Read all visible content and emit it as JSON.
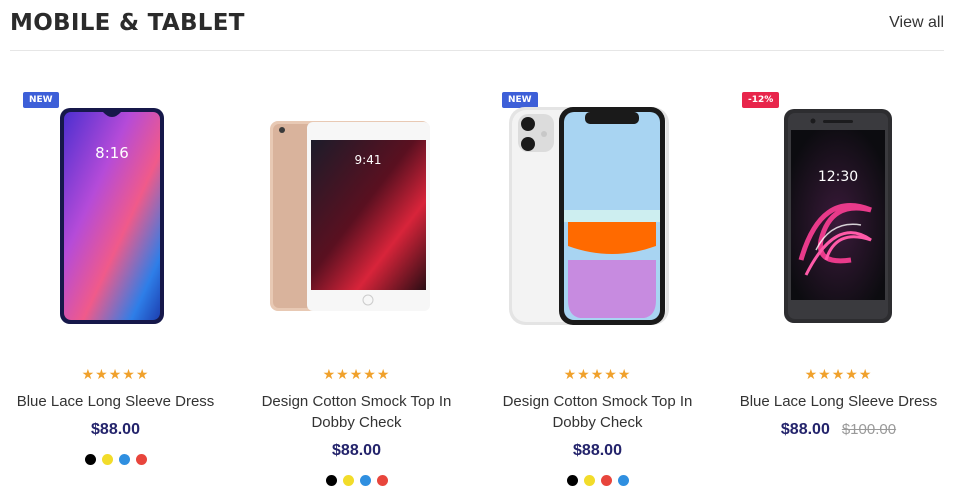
{
  "section": {
    "title": "MOBILE & TABLET",
    "view_all": "View all"
  },
  "colors": {
    "badge_new": "#3d5fd8",
    "badge_sale": "#e8254b",
    "star": "#f0a12c",
    "price": "#23236b"
  },
  "products": [
    {
      "badge": "NEW",
      "badge_type": "new",
      "rating": "★★★★★",
      "title": "Blue Lace Long Sleeve Dress",
      "price": "$88.00",
      "old_price": "",
      "image": "android-phone-icon",
      "swatches": [
        "#000000",
        "#f2dc2a",
        "#2f8fe0",
        "#e8453c"
      ]
    },
    {
      "badge": "",
      "badge_type": "",
      "rating": "★★★★★",
      "title": "Design Cotton Smock Top In Dobby Check",
      "price": "$88.00",
      "old_price": "",
      "image": "ipad-mini-icon",
      "swatches": [
        "#000000",
        "#f2dc2a",
        "#2f8fe0",
        "#e8453c"
      ]
    },
    {
      "badge": "NEW",
      "badge_type": "new",
      "rating": "★★★★★",
      "title": "Design Cotton Smock Top In Dobby Check",
      "price": "$88.00",
      "old_price": "",
      "image": "iphone-11-icon",
      "swatches": [
        "#000000",
        "#f2dc2a",
        "#e8453c",
        "#2f8fe0"
      ]
    },
    {
      "badge": "-12%",
      "badge_type": "sale",
      "rating": "★★★★★",
      "title": "Blue Lace Long Sleeve Dress",
      "price": "$88.00",
      "old_price": "$100.00",
      "image": "dark-android-phone-icon",
      "swatches": []
    }
  ]
}
